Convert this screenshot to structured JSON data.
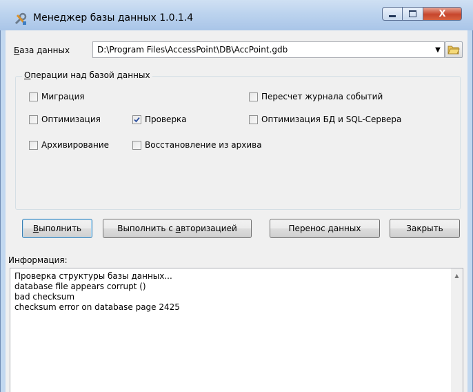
{
  "window": {
    "title": "Менеджер базы данных 1.0.1.4",
    "close_glyph": "X"
  },
  "database": {
    "label_accel": "Б",
    "label_rest": "аза данных",
    "path": "D:\\Program Files\\AccessPoint\\DB\\AccPoint.gdb"
  },
  "operations": {
    "title_accel": "О",
    "title_rest": "перации над базой данных",
    "items": [
      {
        "label": "Миграция",
        "checked": false
      },
      {
        "label": "Пересчет журнала событий",
        "checked": false
      },
      {
        "label": "Оптимизация",
        "checked": false
      },
      {
        "label": "Проверка",
        "checked": true
      },
      {
        "label": "Оптимизация БД и SQL-Сервера",
        "checked": false
      },
      {
        "label": "Архивирование",
        "checked": false
      },
      {
        "label": "Восстановление из архива",
        "checked": false
      }
    ]
  },
  "buttons": {
    "execute_accel": "В",
    "execute_rest": "ыполнить",
    "execute_auth_pre": "Выполнить с ",
    "execute_auth_accel": "а",
    "execute_auth_post": "вторизацией",
    "transfer": "Перенос данных",
    "close": "Закрыть"
  },
  "info": {
    "label": "Информация:",
    "lines": [
      "Проверка структуры базы данных...",
      "database file appears corrupt ()",
      "bad checksum",
      "checksum error on database page 2425"
    ]
  },
  "colors": {
    "accent": "#3c7fb1",
    "close_button": "#c7462c"
  }
}
